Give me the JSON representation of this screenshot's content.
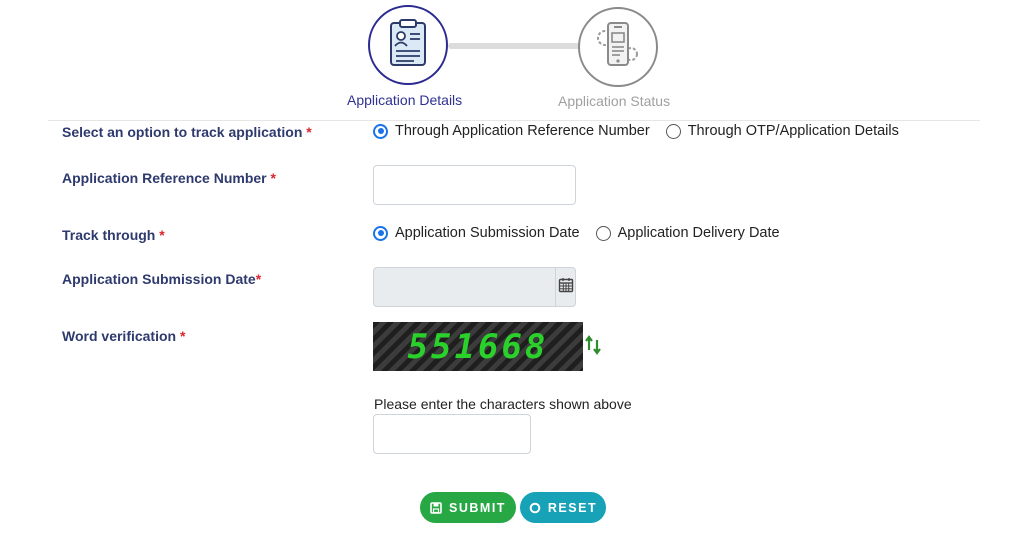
{
  "stepper": {
    "steps": [
      {
        "label": "Application Details",
        "state": "active",
        "icon": "clipboard-profile-icon"
      },
      {
        "label": "Application Status",
        "state": "inactive",
        "icon": "phone-settings-icon"
      }
    ]
  },
  "form": {
    "track_option": {
      "label": "Select an option to track application",
      "required": "*",
      "options": [
        {
          "label": "Through Application Reference Number",
          "checked": true
        },
        {
          "label": "Through OTP/Application Details",
          "checked": false
        }
      ]
    },
    "reference_number": {
      "label": "Application Reference Number",
      "required": "*",
      "value": ""
    },
    "track_through": {
      "label": "Track through",
      "required": "*",
      "options": [
        {
          "label": "Application Submission Date",
          "checked": true
        },
        {
          "label": "Application Delivery Date",
          "checked": false
        }
      ]
    },
    "submission_date": {
      "label": "Application Submission Date",
      "required": "*",
      "value": "",
      "icon": "calendar-icon"
    },
    "word_verification": {
      "label": "Word verification",
      "required": "*",
      "captcha_text": "551668",
      "refresh_icon": "refresh-icon",
      "hint": "Please enter the characters shown above",
      "value": ""
    }
  },
  "buttons": {
    "submit_label": "SUBMIT",
    "reset_label": "RESET"
  },
  "colors": {
    "accent": "#2e3192",
    "label": "#2e3a6e",
    "required": "#d9262f",
    "submit": "#28a745",
    "reset": "#17a2b8",
    "captcha_text": "#2bd12b"
  }
}
